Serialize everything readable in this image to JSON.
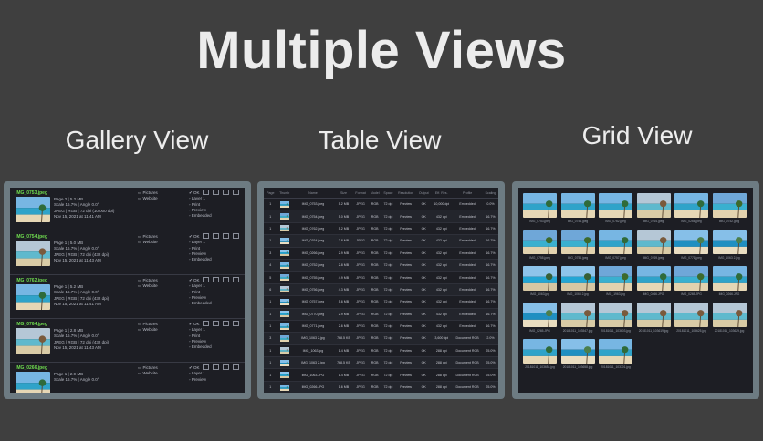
{
  "headline": "Multiple Views",
  "views": {
    "gallery": "Gallery View",
    "table": "Table View",
    "grid": "Grid View"
  },
  "gallery": {
    "items": [
      {
        "name": "IMG_0753.jpeg",
        "folders": [
          "Pictures",
          "Website"
        ],
        "meta": [
          "Page 2 | 5.2 MB",
          "Scale 16.7% | Angle 0.0°",
          "JPEG | RGB | 72 dpi (10,000 dpi)",
          "Nov 15, 2021 at 11:41 AM"
        ],
        "status": [
          "OK",
          "Layer 1",
          "Print",
          "Preview",
          "Embedded"
        ]
      },
      {
        "name": "IMG_0754.jpeg",
        "folders": [
          "Pictures",
          "Website"
        ],
        "meta": [
          "Page 1 | 5.0 MB",
          "Scale 16.7% | Angle 0.0°",
          "JPEG | RGB | 72 dpi (432 dpi)",
          "Nov 15, 2021 at 11:43 AM"
        ],
        "status": [
          "OK",
          "Layer 1",
          "Print",
          "Preview",
          "Embedded"
        ]
      },
      {
        "name": "IMG_0762.jpeg",
        "folders": [
          "Pictures",
          "Website"
        ],
        "meta": [
          "Page 1 | 5.2 MB",
          "Scale 16.7% | Angle 0.0°",
          "JPEG | RGB | 72 dpi (432 dpi)",
          "Nov 15, 2021 at 11:41 AM"
        ],
        "status": [
          "OK",
          "Layer 1",
          "Print",
          "Preview",
          "Embedded"
        ]
      },
      {
        "name": "IMG_0764.jpeg",
        "folders": [
          "Pictures",
          "Website"
        ],
        "meta": [
          "Page 1 | 2.8 MB",
          "Scale 16.7% | Angle 0.0°",
          "JPEG | RGB | 72 dpi (432 dpi)",
          "Nov 15, 2021 at 11:43 AM"
        ],
        "status": [
          "OK",
          "Layer 1",
          "Print",
          "Preview",
          "Embedded"
        ]
      },
      {
        "name": "IMG_0266.jpeg",
        "folders": [
          "Pictures",
          "Website"
        ],
        "meta": [
          "Page 1 | 2.9 MB",
          "Scale 16.7% | Angle 0.0°"
        ],
        "status": [
          "OK",
          "Layer 1",
          "Preview"
        ]
      }
    ]
  },
  "table": {
    "headers": [
      "Page",
      "Thumb",
      "Name",
      "Size",
      "Format",
      "Model",
      "Space",
      "Resolution",
      "Output",
      "Eff. Res.",
      "Profile",
      "Scaling"
    ],
    "rows": [
      [
        "1",
        "",
        "IMG_0753.jpeg",
        "5.2 MB",
        "JPEG",
        "RGB",
        "72 dpi",
        "Preview",
        "OK",
        "10,000 dpi",
        "Embedded",
        "0.0%"
      ],
      [
        "1",
        "",
        "IMG_0754.jpeg",
        "5.0 MB",
        "JPEG",
        "RGB",
        "72 dpi",
        "Preview",
        "OK",
        "432 dpi",
        "Embedded",
        "16.7%"
      ],
      [
        "1",
        "",
        "IMG_0762.jpeg",
        "5.2 MB",
        "JPEG",
        "RGB",
        "72 dpi",
        "Preview",
        "OK",
        "432 dpi",
        "Embedded",
        "16.7%"
      ],
      [
        "1",
        "",
        "IMG_0764.jpeg",
        "2.8 MB",
        "JPEG",
        "RGB",
        "72 dpi",
        "Preview",
        "OK",
        "432 dpi",
        "Embedded",
        "16.7%"
      ],
      [
        "3",
        "",
        "IMG_0266.jpeg",
        "2.9 MB",
        "JPEG",
        "RGB",
        "72 dpi",
        "Preview",
        "OK",
        "432 dpi",
        "Embedded",
        "16.7%"
      ],
      [
        "4",
        "",
        "IMG_0752.jpeg",
        "2.8 MB",
        "JPEG",
        "RGB",
        "72 dpi",
        "Preview",
        "OK",
        "432 dpi",
        "Embedded",
        "16.7%"
      ],
      [
        "5",
        "",
        "IMG_0755.jpeg",
        "4.9 MB",
        "JPEG",
        "RGB",
        "72 dpi",
        "Preview",
        "OK",
        "432 dpi",
        "Embedded",
        "16.7%"
      ],
      [
        "6",
        "",
        "IMG_0756.jpeg",
        "4.3 MB",
        "JPEG",
        "RGB",
        "72 dpi",
        "Preview",
        "OK",
        "432 dpi",
        "Embedded",
        "16.7%"
      ],
      [
        "1",
        "",
        "IMG_0757.jpeg",
        "5.6 MB",
        "JPEG",
        "RGB",
        "72 dpi",
        "Preview",
        "OK",
        "432 dpi",
        "Embedded",
        "16.7%"
      ],
      [
        "1",
        "",
        "IMG_0770.jpeg",
        "2.9 MB",
        "JPEG",
        "RGB",
        "72 dpi",
        "Preview",
        "OK",
        "432 dpi",
        "Embedded",
        "16.7%"
      ],
      [
        "1",
        "",
        "IMG_0771.jpeg",
        "2.6 MB",
        "JPEG",
        "RGB",
        "72 dpi",
        "Preview",
        "OK",
        "432 dpi",
        "Embedded",
        "16.7%"
      ],
      [
        "3",
        "",
        "IMG_1063 2.jpg",
        "768.5 KB",
        "JPEG",
        "RGB",
        "72 dpi",
        "Preview",
        "OK",
        "3,600 dpi",
        "Document RGB",
        "2.0%"
      ],
      [
        "1",
        "",
        "IMG_1063.jpg",
        "1.4 MB",
        "JPEG",
        "RGB",
        "72 dpi",
        "Preview",
        "OK",
        "288 dpi",
        "Document RGB",
        "25.0%"
      ],
      [
        "1",
        "",
        "IMG_1063 2.jpg",
        "768.5 KB",
        "JPEG",
        "RGB",
        "72 dpi",
        "Preview",
        "OK",
        "288 dpi",
        "Document RGB",
        "25.0%"
      ],
      [
        "1",
        "",
        "IMG_1063.JPG",
        "1.4 MB",
        "JPEG",
        "RGB",
        "72 dpi",
        "Preview",
        "OK",
        "288 dpi",
        "Document RGB",
        "25.0%"
      ],
      [
        "1",
        "",
        "IMG_0266.JPG",
        "1.6 MB",
        "JPEG",
        "RGB",
        "72 dpi",
        "Preview",
        "OK",
        "288 dpi",
        "Document RGB",
        "25.0%"
      ],
      [
        "1",
        "",
        "IMG_1963.jpg",
        "1.5 MB",
        "JPEG",
        "RGB",
        "72 dpi",
        "Preview",
        "OK",
        "5,714 dpi",
        "Document RGB",
        "1.3%"
      ],
      [
        "1",
        "",
        "IMG_0265.JPG",
        "1.6 MB",
        "JPEG",
        "RGB",
        "72 dpi",
        "Preview",
        "OK",
        "7,200 dpi",
        "Document RGB",
        "1.0%"
      ],
      [
        "PB 15",
        "",
        "IMG_0265.JPG",
        "1.4 MB",
        "JPEG",
        "RGB",
        "72 dpi",
        "Preview",
        "OK",
        "7,200 dpi",
        "Document RGB",
        "1.0%"
      ],
      [
        "1",
        "",
        "20181011_103547.jpg",
        "1.5 MB",
        "JPEG",
        "RGB",
        "72 dpi",
        "Preview",
        "OK",
        "288 dpi",
        "Document RGB",
        "25.0%"
      ]
    ]
  },
  "grid": {
    "items": [
      {
        "cap": "IMG_0753.jpeg",
        "scene": "beach"
      },
      {
        "cap": "IMG_0754.jpeg",
        "scene": "beach"
      },
      {
        "cap": "IMG_0762.jpeg",
        "scene": "beach"
      },
      {
        "cap": "IMG_0764.jpeg",
        "scene": "hut"
      },
      {
        "cap": "IMG_0266.jpeg",
        "scene": "beach"
      },
      {
        "cap": "IMG_0752.jpeg",
        "scene": "palm"
      },
      {
        "cap": "IMG_0755.jpeg",
        "scene": "palm"
      },
      {
        "cap": "IMG_0756.jpeg",
        "scene": "palm"
      },
      {
        "cap": "IMG_0757.jpeg",
        "scene": "beach"
      },
      {
        "cap": "IMG_0769.jpeg",
        "scene": "hut"
      },
      {
        "cap": "IMG_0771.jpeg",
        "scene": "sea"
      },
      {
        "cap": "IMG_1063 2.jpg",
        "scene": "sea"
      },
      {
        "cap": "IMG_1063.jpg",
        "scene": "pool"
      },
      {
        "cap": "IMG_1063 2.jpg",
        "scene": "pool"
      },
      {
        "cap": "IMG_1963.jpg",
        "scene": "palm"
      },
      {
        "cap": "IMG_0266.JPG",
        "scene": "beach"
      },
      {
        "cap": "IMG_0265.JPG",
        "scene": "palm"
      },
      {
        "cap": "IMG_0266.JPG",
        "scene": "beach"
      },
      {
        "cap": "IMG_0265.JPG",
        "scene": "sea"
      },
      {
        "cap": "20181011_103547.jpg",
        "scene": "hut"
      },
      {
        "cap": "20181011_103603.jpg",
        "scene": "hut"
      },
      {
        "cap": "20181011_103619.jpg",
        "scene": "hut"
      },
      {
        "cap": "20181011_103625.jpg",
        "scene": "hut"
      },
      {
        "cap": "20181011_103629.jpg",
        "scene": "hut"
      },
      {
        "cap": "20181011_103654.jpg",
        "scene": "beach"
      },
      {
        "cap": "20181011_103658.jpg",
        "scene": "sea"
      },
      {
        "cap": "20181011_103701.jpg",
        "scene": "beach"
      }
    ]
  },
  "colors": {
    "background": "#3f3f3f",
    "panel_frame": "#6d7b82",
    "app_bg": "#1d1e24",
    "file_name_green": "#6fdc4f"
  }
}
